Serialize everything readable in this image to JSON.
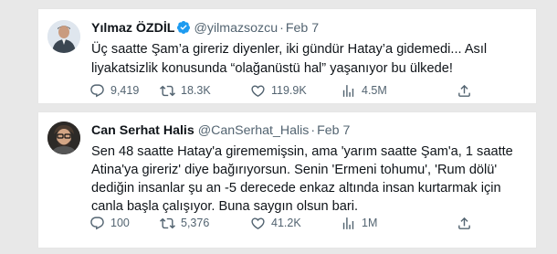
{
  "tweets": [
    {
      "name": "Yılmaz ÖZDİL",
      "handle": "@yilmazsozcu",
      "dot": "·",
      "date": "Feb 7",
      "verified": true,
      "lines": [
        "Üç saatte Şam’a gireriz diyenler, iki gündür Hatay’a gidemedi... Asıl",
        "liyakatsizlik konusunda “olağanüstü hal” yaşanıyor bu ülkede!"
      ],
      "replies": "9,419",
      "retweets": "18.3K",
      "likes": "119.9K",
      "views": "4.5M"
    },
    {
      "name": "Can Serhat Halis",
      "handle": "@CanSerhat_Halis",
      "dot": "·",
      "date": "Feb 7",
      "verified": false,
      "lines": [
        "Sen 48 saatte Hatay'a girememişsin, ama 'yarım saatte Şam'a, 1 saatte",
        "Atina'ya gireriz' diye bağırıyorsun. Senin 'Ermeni tohumu', 'Rum dölü'",
        "dediğin insanlar şu an -5 derecede enkaz altında insan kurtarmak için",
        "canla başla çalışıyor. Buna saygın olsun bari."
      ],
      "replies": "100",
      "retweets": "5,376",
      "likes": "41.2K",
      "views": "1M"
    }
  ],
  "colors": {
    "verified": "#1d9bf0",
    "muted": "#536471",
    "text": "#0f1419"
  },
  "icons": [
    "verified-badge-icon",
    "reply-icon",
    "retweet-icon",
    "like-icon",
    "views-icon",
    "share-icon"
  ]
}
